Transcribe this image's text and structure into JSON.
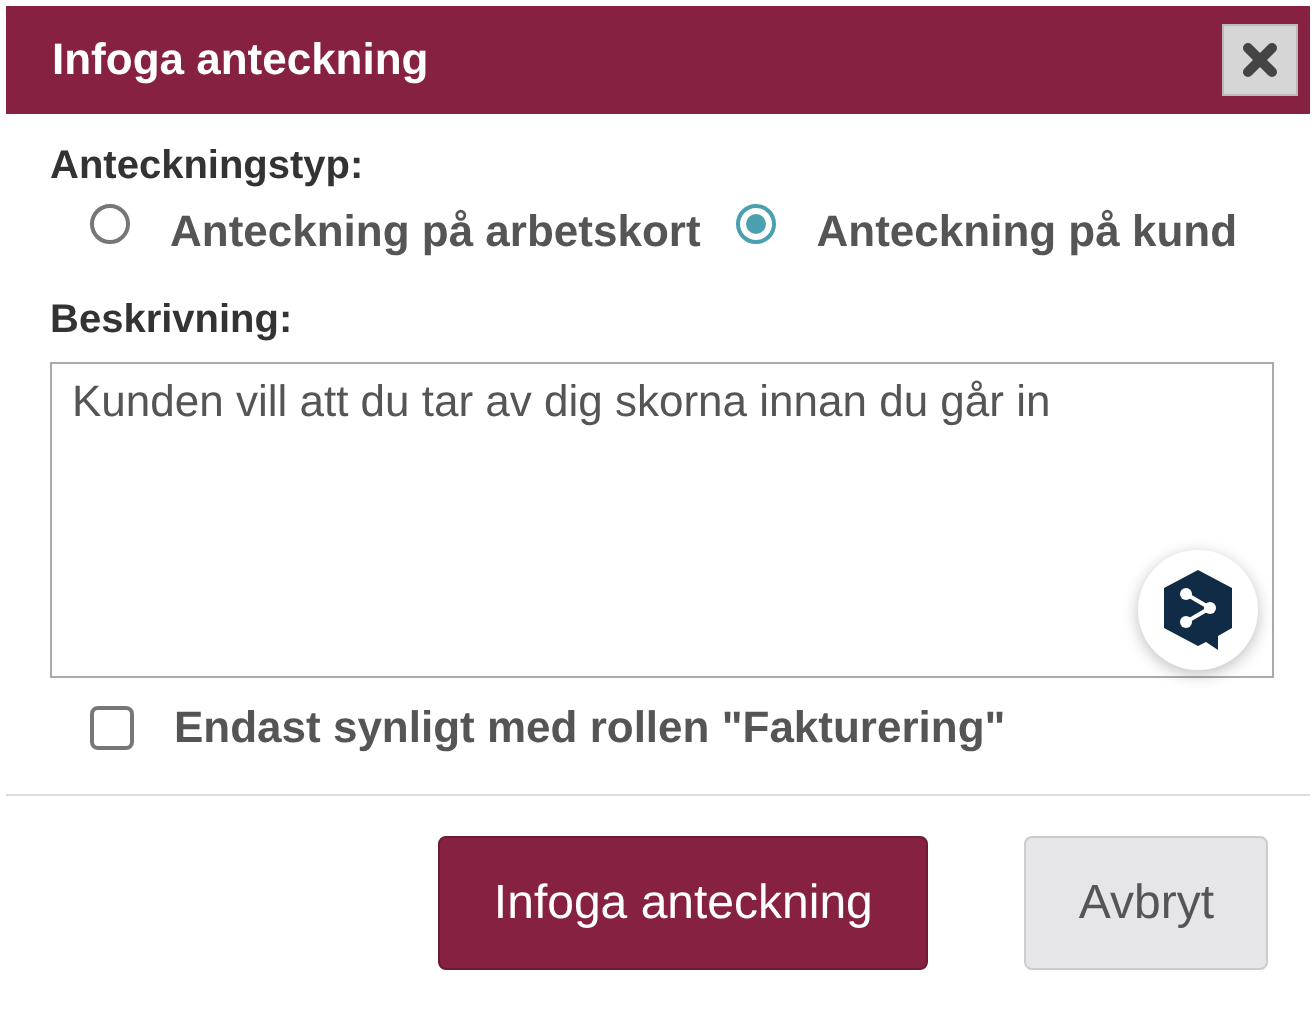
{
  "dialog": {
    "title": "Infoga anteckning"
  },
  "note_type": {
    "label": "Anteckningstyp:",
    "options": [
      {
        "label": "Anteckning på arbetskort",
        "selected": false
      },
      {
        "label": "Anteckning på kund",
        "selected": true
      }
    ]
  },
  "description": {
    "label": "Beskrivning:",
    "value": "Kunden vill att du tar av dig skorna innan du går in"
  },
  "restricted": {
    "label": "Endast synligt med rollen \"Fakturering\"",
    "checked": false
  },
  "buttons": [
    {
      "label": "Infoga anteckning",
      "kind": "primary"
    },
    {
      "label": "Avbryt",
      "kind": "secondary"
    }
  ]
}
